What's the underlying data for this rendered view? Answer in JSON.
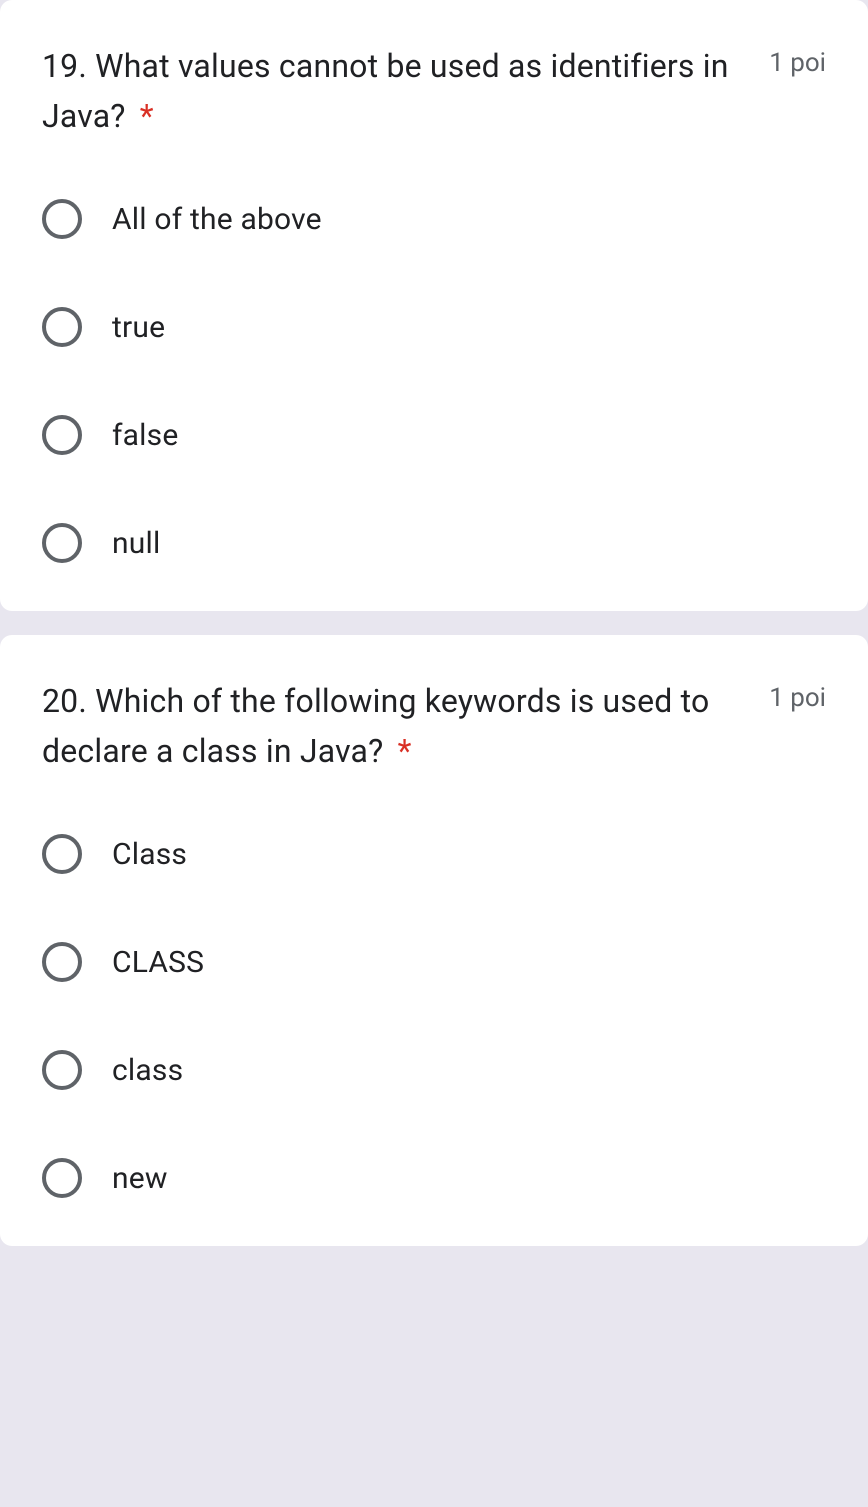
{
  "questions": [
    {
      "title": "19. What values cannot be used as identifiers in Java?",
      "required_mark": "*",
      "points": "1 poi",
      "options": [
        {
          "label": "All of the above"
        },
        {
          "label": "true"
        },
        {
          "label": "false"
        },
        {
          "label": "null"
        }
      ]
    },
    {
      "title": "20. Which of the following keywords is used to declare a class in Java?",
      "required_mark": "*",
      "points": "1 poi",
      "options": [
        {
          "label": "Class"
        },
        {
          "label": "CLASS"
        },
        {
          "label": "class"
        },
        {
          "label": "new"
        }
      ]
    }
  ]
}
